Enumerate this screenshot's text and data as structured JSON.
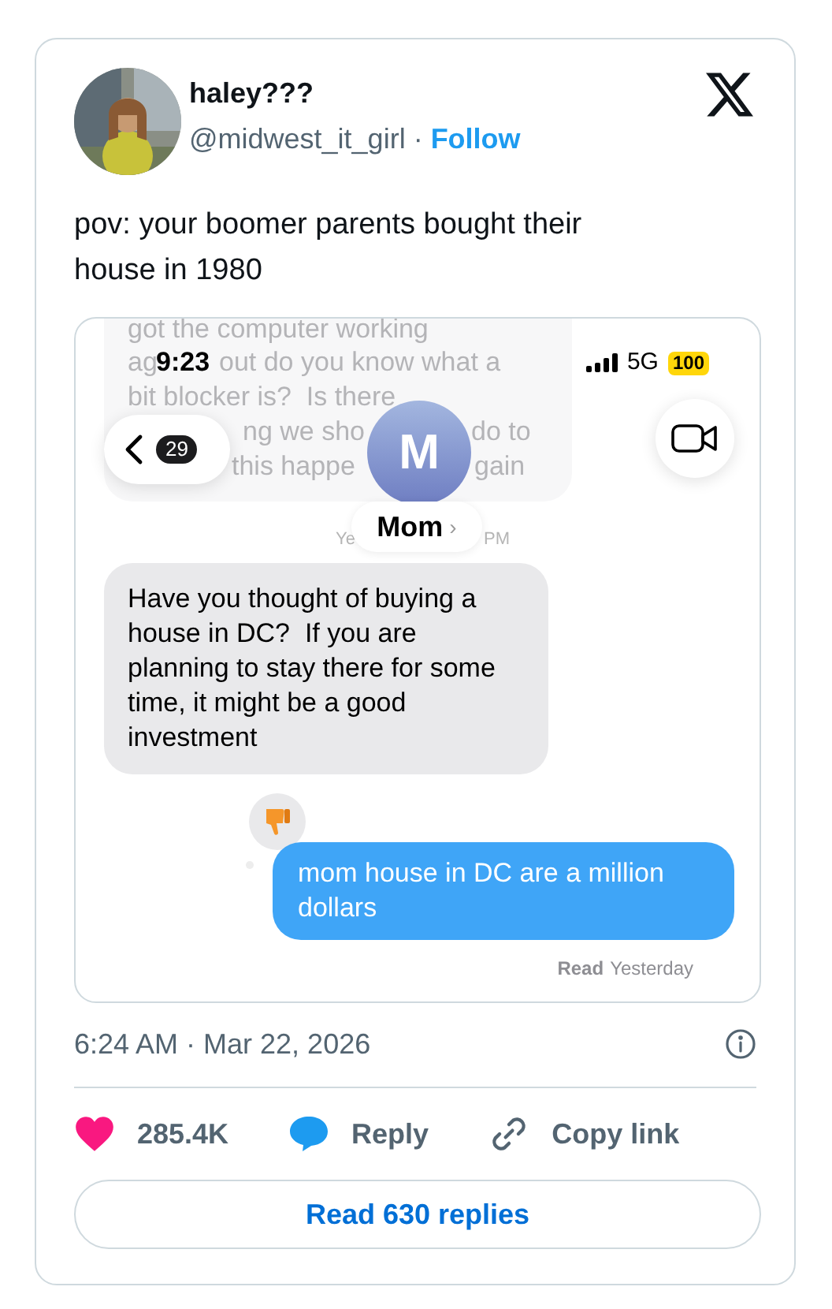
{
  "author": {
    "name": "haley???",
    "handle": "@midwest_it_girl",
    "separator": "·",
    "follow": "Follow"
  },
  "text": "pov: your boomer parents bought their house in 1980",
  "screenshot": {
    "faded_message": [
      "got the computer working",
      "ag",
      "out do you know what a",
      "bit blocker is?  Is there",
      "ng we sho",
      "do to",
      "this happe",
      "gain"
    ],
    "faded_timestamp": [
      "Ye",
      "PM"
    ],
    "status": {
      "time": "9:23",
      "network": "5G",
      "battery": "100"
    },
    "back_count": "29",
    "contact": {
      "initial": "M",
      "name": "Mom",
      "chevron": "›"
    },
    "messages": [
      {
        "kind": "received",
        "text": "Have you thought of buying a house in DC?  If you are planning to stay there for some time, it might be a good investment"
      },
      {
        "kind": "sent",
        "text": "mom house in DC are a million dollars",
        "reacted": true
      }
    ],
    "receipt": {
      "label": "Read",
      "time": "Yesterday"
    }
  },
  "timestamp": "6:24 AM · Mar 22, 2026",
  "actions": [
    {
      "kind": "like",
      "label": "285.4K"
    },
    {
      "kind": "reply",
      "label": "Reply"
    },
    {
      "kind": "copy",
      "label": "Copy link"
    }
  ],
  "read_replies": "Read 630 replies"
}
